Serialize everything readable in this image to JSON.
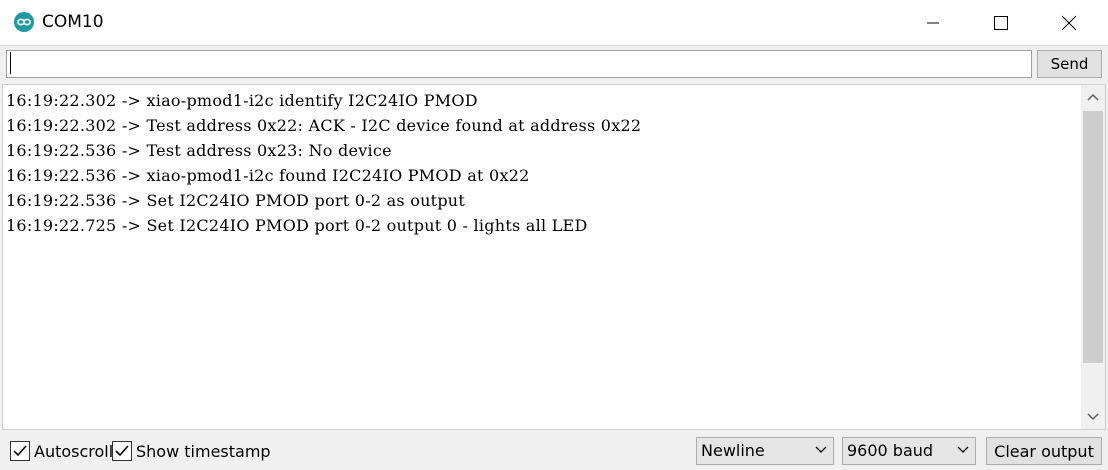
{
  "window": {
    "title": "COM10",
    "app_icon": "arduino-icon",
    "controls": [
      "minimize-icon",
      "maximize-icon",
      "close-icon"
    ]
  },
  "toolbar": {
    "input_value": "",
    "send_label": "Send"
  },
  "output": {
    "lines": [
      "16:19:22.302 -> xiao-pmod1-i2c identify I2C24IO PMOD",
      "16:19:22.302 -> Test address 0x22: ACK - I2C device found at address 0x22",
      "16:19:22.536 -> Test address 0x23: No device",
      "16:19:22.536 -> xiao-pmod1-i2c found I2C24IO PMOD at 0x22",
      "16:19:22.536 -> Set I2C24IO PMOD port 0-2 as output",
      "16:19:22.725 -> Set I2C24IO PMOD port 0-2 output 0 - lights all LED"
    ]
  },
  "status": {
    "autoscroll_label": "Autoscroll",
    "autoscroll_checked": true,
    "timestamp_label": "Show timestamp",
    "timestamp_checked": true,
    "line_ending": "Newline",
    "baud": "9600 baud",
    "clear_label": "Clear output"
  },
  "colors": {
    "accent": "#1c9aa0"
  }
}
